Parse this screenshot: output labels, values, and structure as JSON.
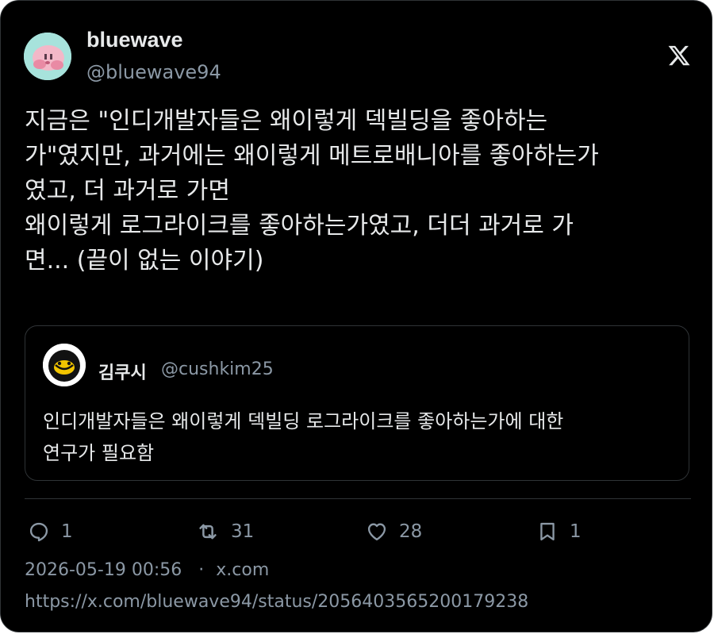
{
  "author": {
    "name": "bluewave",
    "handle": "@bluewave94"
  },
  "tweet": {
    "text": "지금은 \"인디개발자들은 왜이렇게 덱빌딩을 좋아하는\n가\"였지만, 과거에는 왜이렇게 메트로배니아를 좋아하는가\n였고, 더 과거로 가면\n왜이렇게 로그라이크를 좋아하는가였고, 더더 과거로 가\n면... (끝이 없는 이야기)"
  },
  "quote": {
    "name": "김쿠시",
    "handle": "@cushkim25",
    "text": "인디개발자들은 왜이렇게 덱빌딩 로그라이크를 좋아하는가에 대한\n연구가 필요함"
  },
  "actions": {
    "replies": "1",
    "retweets": "31",
    "likes": "28",
    "bookmarks": "1"
  },
  "meta": {
    "timestamp": "2026-05-19 00:56",
    "separator": "·",
    "source": "x.com",
    "url": "https://x.com/bluewave94/status/2056403565200179238"
  },
  "icons": {
    "brand": "x-logo-icon",
    "reply": "reply-icon",
    "retweet": "retweet-icon",
    "like": "heart-icon",
    "bookmark": "bookmark-icon"
  },
  "colors": {
    "background": "#000000",
    "text": "#e7e9ea",
    "secondary": "#8b98a5",
    "border": "#2f3336"
  }
}
